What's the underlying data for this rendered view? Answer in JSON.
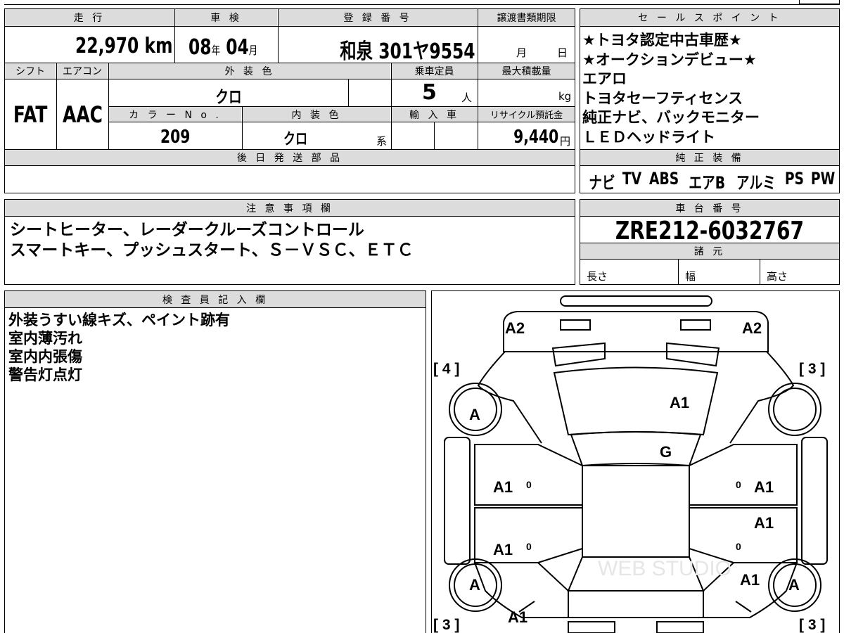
{
  "vehicle_info": {
    "mileage_label": "走 行",
    "mileage_value": "22,970",
    "mileage_unit": "km",
    "shaken_label": "車 検",
    "shaken_year": "08",
    "shaken_year_unit": "年",
    "shaken_month": "04",
    "shaken_month_unit": "月",
    "registration_label": "登 録 番 号",
    "registration_value": "和泉 301ヤ9554",
    "transfer_deadline_label": "譲渡書類期限",
    "transfer_month_unit": "月",
    "transfer_day_unit": "日",
    "shift_label": "シフト",
    "shift_value": "FAT",
    "aircon_label": "エアコン",
    "aircon_value": "AAC",
    "exterior_color_label": "外 装 色",
    "exterior_color_value": "クロ",
    "capacity_label": "乗車定員",
    "capacity_value": "5",
    "capacity_unit": "人",
    "max_load_label": "最大積載量",
    "max_load_unit": "kg",
    "color_no_label": "カ ラ ー N o .",
    "color_no_value": "209",
    "interior_color_label": "内 装 色",
    "interior_color_value": "クロ",
    "interior_color_suffix": "系",
    "import_label": "輸 入 車",
    "recycle_label": "リサイクル預託金",
    "recycle_value": "9,440",
    "recycle_unit": "円",
    "later_parts_label": "後 日 発 送 部 品"
  },
  "sales_points": {
    "label": "セ ー ル ス ポ イ ン ト",
    "items": [
      "★トヨタ認定中古車歴★",
      "★オークションデビュー★",
      "エアロ",
      "トヨタセーフティセンス",
      "純正ナビ、バックモニター",
      "ＬＥＤヘッドライト"
    ]
  },
  "equipment": {
    "label": "純 正 装 備",
    "items": [
      "ナビ",
      "TV",
      "ABS",
      "エアB",
      "アルミ",
      "PS",
      "PW"
    ]
  },
  "caution": {
    "label": "注 意 事 項 欄",
    "lines": [
      "シートヒーター、レーダークルーズコントロール",
      "スマートキー、プッシュスタート、Ｓ－ＶＳＣ、ＥＴＣ"
    ]
  },
  "chassis": {
    "label": "車 台 番 号",
    "value": "ZRE212-6032767",
    "specs_label": "諸 元",
    "length_label": "長さ",
    "width_label": "幅",
    "height_label": "高さ"
  },
  "inspector": {
    "label": "検 査 員 記 入 欄",
    "lines": [
      "外装うすい線キズ、ペイント跡有",
      "室内薄汚れ",
      "室内内張傷",
      "警告灯点灯"
    ]
  },
  "diagram": {
    "marks": {
      "front_left_bumper": "A2",
      "front_right_bumper": "A2",
      "bonnet": "A1",
      "windshield": "G",
      "front_left_door": "A1",
      "rear_left_door": "A1",
      "front_right_door": "A1",
      "rear_right_door": "A1",
      "rear_right_quarter": "A1",
      "rear_left_quarter": "A1",
      "front_left_wheel": "A",
      "rear_left_wheel": "A",
      "rear_right_wheel": "A"
    },
    "tires": {
      "front_left": "[ 4 ]",
      "front_right": "[ 3 ]",
      "rear_left": "[ 3 ]",
      "rear_right": "[ 3 ]"
    },
    "watermark": "WEB STUDIO"
  }
}
